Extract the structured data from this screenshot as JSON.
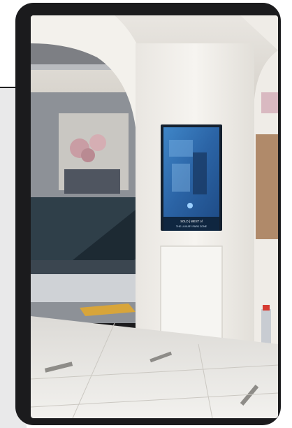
{
  "kiosk": {
    "screen_line1": "SOLD | WEST of",
    "screen_line2": "THE LUXURY PARK ZONE"
  },
  "colors": {
    "frame": "#1b1b1d",
    "wall": "#f1efea",
    "floor": "#e6e4df",
    "kiosk_screen": "#2e6fb3"
  }
}
